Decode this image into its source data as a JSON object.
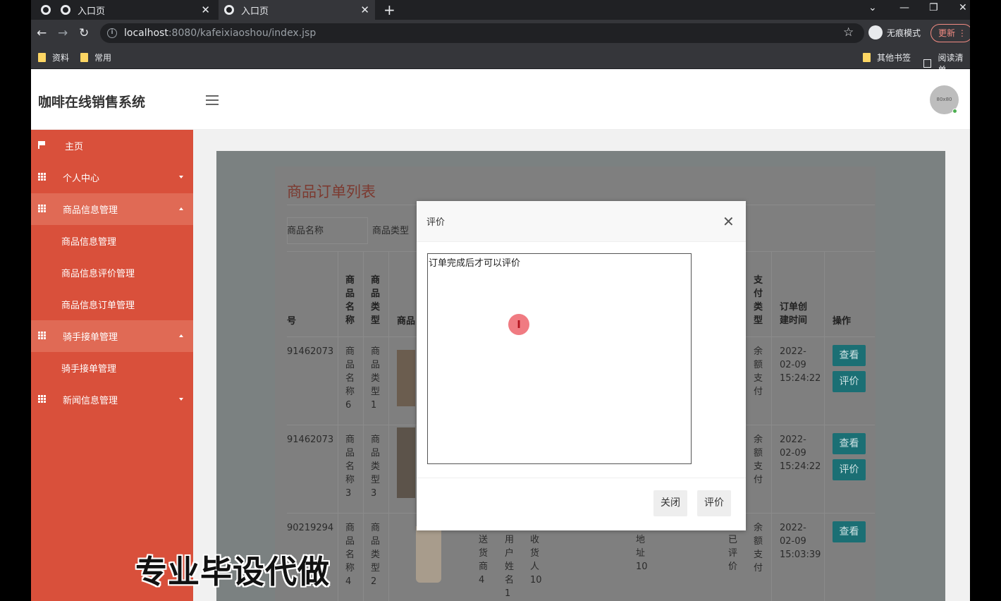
{
  "browser": {
    "tabs": [
      {
        "label": "入口页",
        "active": false
      },
      {
        "label": "入口页",
        "active": true
      }
    ],
    "url_host": "localhost",
    "url_path": ":8080/kafeixiaoshou/index.jsp",
    "incognito_label": "无痕模式",
    "update_label": "更新",
    "bookmarks": [
      "资料",
      "常用"
    ],
    "bookmarks_right": [
      "其他书签",
      "阅读清单"
    ]
  },
  "app": {
    "title": "咖啡在线销售系统",
    "avatar_text": "80x80"
  },
  "sidebar": {
    "items": [
      {
        "label": "主页"
      },
      {
        "label": "个人中心"
      },
      {
        "label": "商品信息管理"
      },
      {
        "label": "商品信息管理"
      },
      {
        "label": "商品信息评价管理"
      },
      {
        "label": "商品信息订单管理"
      },
      {
        "label": "骑手接单管理"
      },
      {
        "label": "骑手接单管理"
      },
      {
        "label": "新闻信息管理"
      }
    ]
  },
  "panel": {
    "title": "商品订单列表",
    "search_labels": [
      "商品名称",
      "商品类型"
    ],
    "headers": {
      "id_partial": "号",
      "name": "商品名称",
      "type": "商品类型",
      "image": "商品",
      "pay_type": "支付类型",
      "created": "订单创建时间",
      "action": "操作"
    },
    "rows": [
      {
        "id": "91462073",
        "name": "商品名称6",
        "type": "商品类型1",
        "pay": "余额支付",
        "created": "2022-02-09 15:24:22"
      },
      {
        "id": "91462073",
        "name": "商品名称3",
        "type": "商品类型3",
        "pay": "余额支付",
        "created": "2022-02-09 15:24:22"
      },
      {
        "id": "90219294",
        "name": "商品名称4",
        "type": "商品类型2",
        "pay": "余额支付",
        "created": "2022-02-09 15:03:39",
        "extra": [
          "送货商4",
          "用户姓名1",
          "收货人10",
          "地址10",
          "已评价"
        ]
      }
    ],
    "view_label": "查看",
    "review_label": "评价"
  },
  "modal": {
    "title": "评价",
    "textarea_value": "订单完成后才可以评价",
    "close_label": "关闭",
    "submit_label": "评价"
  },
  "watermark": "专业毕设代做"
}
